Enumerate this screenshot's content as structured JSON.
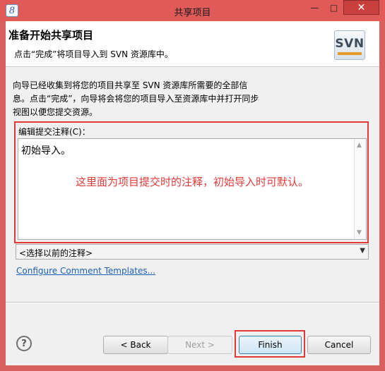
{
  "window": {
    "title": "共享项目",
    "icon": "eclipse-icon",
    "icon_glyph": "8",
    "min_glyph": "—",
    "max_glyph": "□",
    "close_glyph": "✕"
  },
  "header": {
    "title": "准备开始共享项目",
    "description": "点击“完成”将项目导入到 SVN 资源库中。",
    "logo_text": "SVN"
  },
  "info": {
    "lines": [
      "向导已经收集到将您的项目共享至 SVN 资源库所需要的全部信",
      "息。点击“完成”，向导将会将您的项目导入至资源库中并打开同步",
      "视图以便您提交资源。"
    ]
  },
  "comment": {
    "label": "编辑提交注释(C)：",
    "value": "初始导入。",
    "annotation": "这里面为项目提交时的注释，初始导入时可默认。",
    "scroll_up": "▲",
    "scroll_down": "▼"
  },
  "previous_comments": {
    "selected": "<选择以前的注释>",
    "arrow": "▼"
  },
  "links": {
    "configure": "Configure Comment Templates..."
  },
  "buttons": {
    "help": "?",
    "back": "< Back",
    "next": "Next >",
    "finish": "Finish",
    "cancel": "Cancel"
  },
  "colors": {
    "titlebar": "#e05a58",
    "highlight_border": "#e23838",
    "annotation": "#e23a3a",
    "link": "#1a5fb4"
  }
}
